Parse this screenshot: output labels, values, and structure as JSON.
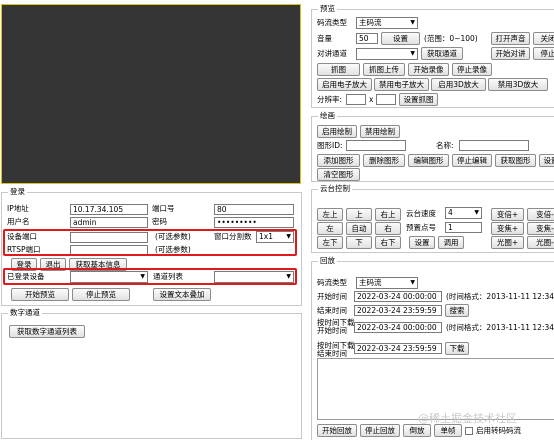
{
  "login": {
    "legend": "登录",
    "ip_label": "IP地址",
    "ip_value": "10.17.34.105",
    "port_label": "端口号",
    "port_value": "80",
    "user_label": "用户名",
    "user_value": "admin",
    "pwd_label": "密码",
    "pwd_value": "•••••••••",
    "dev_port_label": "设备端口",
    "dev_port_hint": "(可选参数)",
    "split_label": "窗口分割数",
    "split_value": "1x1",
    "rtsp_label": "RTSP端口",
    "rtsp_hint": "(可选参数)",
    "login_btn": "登录",
    "logout_btn": "退出",
    "basic_info_btn": "获取基本信息",
    "logged_dev_label": "已登录设备",
    "channel_list_label": "通道列表",
    "start_preview_btn": "开始预览",
    "stop_preview_btn": "停止预览",
    "set_osd_btn": "设置文本叠加"
  },
  "digital": {
    "legend": "数字通道",
    "get_list_btn": "获取数字通道列表"
  },
  "preview": {
    "legend": "预览",
    "stream_label": "码流类型",
    "stream_value": "主码流",
    "volume_label": "音量",
    "volume_value": "50",
    "set_btn": "设置",
    "range_text": "(范围：0~100)",
    "open_sound_btn": "打开声音",
    "close_btn": "关闭",
    "talk_label": "对讲通道",
    "get_talk_btn": "获取通道",
    "start_talk_btn": "开始对讲",
    "stop_btn": "停止",
    "capture_btn": "抓图",
    "capture_upload_btn": "抓图上传",
    "start_record_btn": "开始录像",
    "stop_record_btn": "停止录像",
    "ezoom_on_btn": "启用电子放大",
    "ezoom_off_btn": "禁用电子放大",
    "zoom3d_on_btn": "启用3D放大",
    "zoom3d_off_btn": "禁用3D放大",
    "resolution_label": "分辨率:",
    "res_x": "x",
    "set_capture_btn": "设置抓图"
  },
  "draw": {
    "legend": "绘画",
    "enable_btn": "启用绘制",
    "disable_btn": "禁用绘制",
    "shape_id_label": "图形ID:",
    "name_label": "名称:",
    "add_btn": "添加图形",
    "delete_btn": "删除图形",
    "edit_btn": "编辑图形",
    "stop_edit_btn": "停止编辑",
    "get_btn": "获取图形",
    "set_btn": "设置",
    "clear_btn": "清空图形"
  },
  "ptz": {
    "legend": "云台控制",
    "up_left": "左上",
    "up": "上",
    "up_right": "右上",
    "left": "左",
    "auto": "自动",
    "right": "右",
    "down_left": "左下",
    "down": "下",
    "down_right": "右下",
    "speed_label": "云台速度",
    "speed_value": "4",
    "preset_label": "预置点号",
    "preset_value": "1",
    "set_btn": "设置",
    "call_btn": "调用",
    "zoom_in": "变倍+",
    "zoom_out": "变倍-",
    "focus_in": "变焦+",
    "focus_out": "变焦-",
    "iris_in": "光圈+",
    "iris_out": "光圈-"
  },
  "playback": {
    "legend": "回放",
    "stream_label": "码流类型",
    "stream_value": "主码流",
    "start_label": "开始时间",
    "start_value": "2022-03-24 00:00:00",
    "time_format": "(时间格式：2013-11-11 12:34:56)",
    "end_label": "结束时间",
    "end_value": "2022-03-24 23:59:59",
    "search_btn": "搜索",
    "dl_start_label_1": "按时间下载",
    "dl_start_label_2": "开始时间",
    "dl_start_value": "2022-03-24 00:00:00",
    "dl_format": "(时间格式：2013-11-11 12:34:56)",
    "dl_end_label_1": "按时间下载",
    "dl_end_label_2": "结束时间",
    "dl_end_value": "2022-03-24 23:59:59",
    "download_btn": "下载",
    "start_play_btn": "开始回放",
    "stop_play_btn": "停止回放",
    "reverse_btn": "倒放",
    "frame_btn": "单帧",
    "transcode_label": "启用转码码流"
  },
  "watermark": "@稀土掘金技术社区",
  "colors": {
    "video_bg": "#353535",
    "video_border": "#d8c21c",
    "highlight": "#e0191d"
  }
}
